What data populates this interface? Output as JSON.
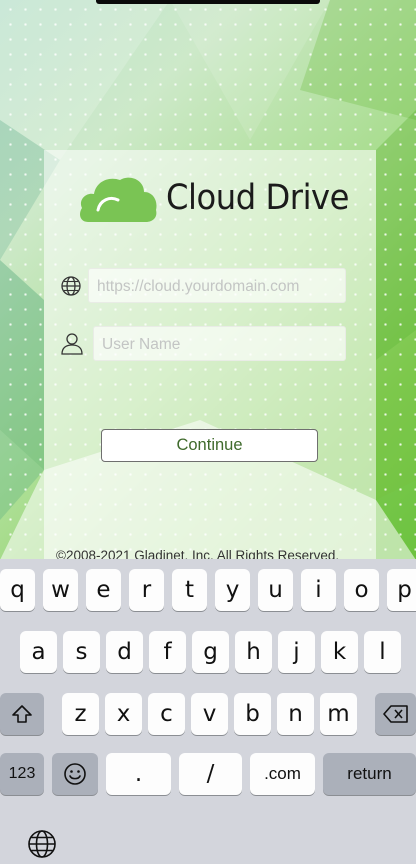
{
  "app": {
    "name": "Cloud Drive",
    "brand_green": "#7ac454"
  },
  "login": {
    "server_placeholder": "https://cloud.yourdomain.com",
    "username_placeholder": "User Name",
    "continue_label": "Continue",
    "copyright": "©2008-2021 Gladinet, Inc. All Rights Reserved."
  },
  "icons": {
    "server": "globe-icon",
    "user": "person-icon",
    "keyboard_globe": "globe-icon",
    "shift": "shift-icon",
    "delete": "backspace-icon",
    "emoji": "emoji-icon"
  },
  "keyboard": {
    "row1": [
      "q",
      "w",
      "e",
      "r",
      "t",
      "y",
      "u",
      "i",
      "o",
      "p"
    ],
    "row2": [
      "a",
      "s",
      "d",
      "f",
      "g",
      "h",
      "j",
      "k",
      "l"
    ],
    "row3": [
      "z",
      "x",
      "c",
      "v",
      "b",
      "n",
      "m"
    ],
    "numbers_label": "123",
    "dot_label": ".",
    "slash_label": "/",
    "dotcom_label": ".com",
    "return_label": "return"
  }
}
